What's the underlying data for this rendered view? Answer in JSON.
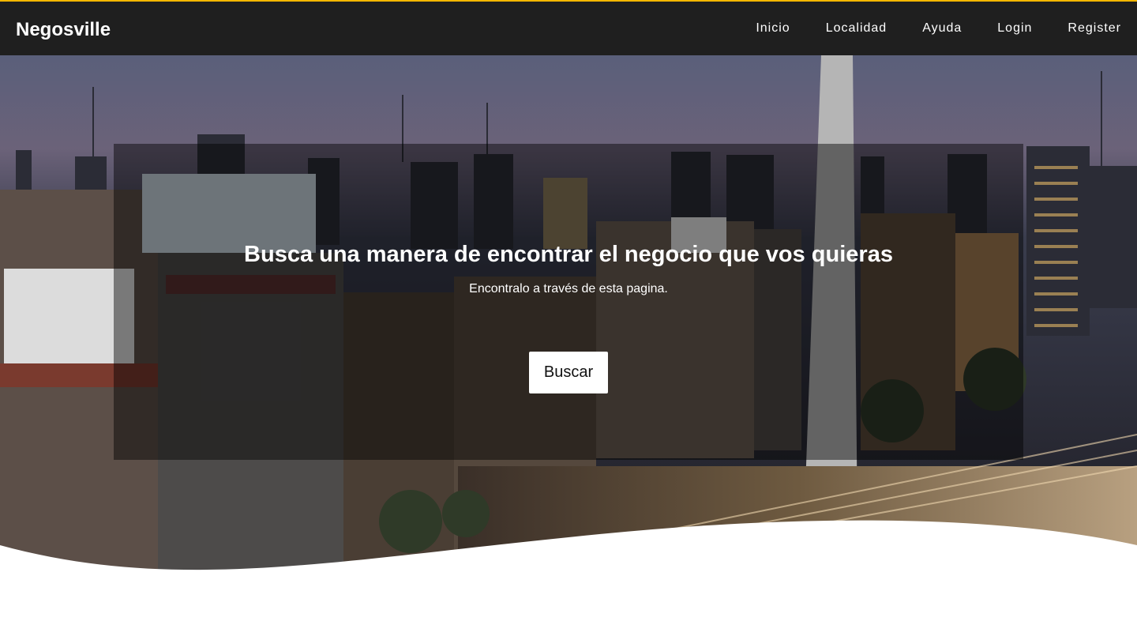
{
  "nav": {
    "brand": "Negosville",
    "links": [
      {
        "label": "Inicio"
      },
      {
        "label": "Localidad"
      },
      {
        "label": "Ayuda"
      },
      {
        "label": "Login"
      },
      {
        "label": "Register"
      }
    ]
  },
  "hero": {
    "title": "Busca una manera de encontrar el negocio que vos quieras",
    "subtitle": "Encontralo a través de esta pagina.",
    "button_label": "Buscar"
  },
  "colors": {
    "navbar_bg": "#1f1f1f",
    "accent_top_border": "#f5b700",
    "overlay": "rgba(0,0,0,0.45)",
    "button_bg": "#ffffff"
  }
}
